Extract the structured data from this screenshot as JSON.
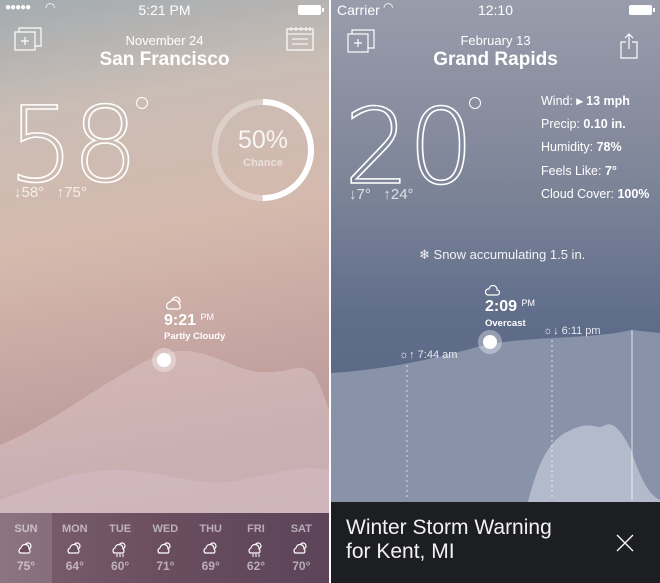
{
  "left": {
    "status": {
      "time": "5:21 PM",
      "signal": "signal-dots",
      "wifi": "wifi-icon",
      "battery": "battery-icon"
    },
    "date": "November 24",
    "city": "San Francisco",
    "temperature": "58",
    "low": "58°",
    "high": "75°",
    "precip_chance": {
      "value": "50%",
      "label": "Chance",
      "fraction": 0.5
    },
    "current": {
      "time": "9:21",
      "ampm": "PM",
      "condition": "Partly Cloudy",
      "icon": "partly-cloudy-icon"
    },
    "forecast": [
      {
        "day": "SUN",
        "temp": "75°",
        "icon": "partly-cloudy"
      },
      {
        "day": "MON",
        "temp": "64°",
        "icon": "partly-cloudy"
      },
      {
        "day": "TUE",
        "temp": "60°",
        "icon": "rain"
      },
      {
        "day": "WED",
        "temp": "71°",
        "icon": "partly-cloudy"
      },
      {
        "day": "THU",
        "temp": "69°",
        "icon": "partly-cloudy"
      },
      {
        "day": "FRI",
        "temp": "62°",
        "icon": "rain"
      },
      {
        "day": "SAT",
        "temp": "70°",
        "icon": "partly-cloudy"
      }
    ]
  },
  "right": {
    "status": {
      "carrier": "Carrier",
      "time": "12:10"
    },
    "date": "February 13",
    "city": "Grand Rapids",
    "temperature": "20",
    "low": "7°",
    "high": "24°",
    "details": [
      {
        "label": "Wind:",
        "value": "▸ 13 mph"
      },
      {
        "label": "Precip:",
        "value": "0.10 in."
      },
      {
        "label": "Humidity:",
        "value": "78%"
      },
      {
        "label": "Feels Like:",
        "value": "7°"
      },
      {
        "label": "Cloud Cover:",
        "value": "100%"
      }
    ],
    "snow_note": "Snow accumulating 1.5 in.",
    "current": {
      "time": "2:09",
      "ampm": "PM",
      "condition": "Overcast",
      "icon": "cloud-icon"
    },
    "sunrise": "7:44 am",
    "sunset": "6:11 pm",
    "alert": {
      "title": "Winter Storm Warning",
      "subtitle": "for Kent, MI"
    }
  },
  "colors": {
    "banner": "#1d1e22",
    "forecast_bar": "#6a4d5f"
  }
}
